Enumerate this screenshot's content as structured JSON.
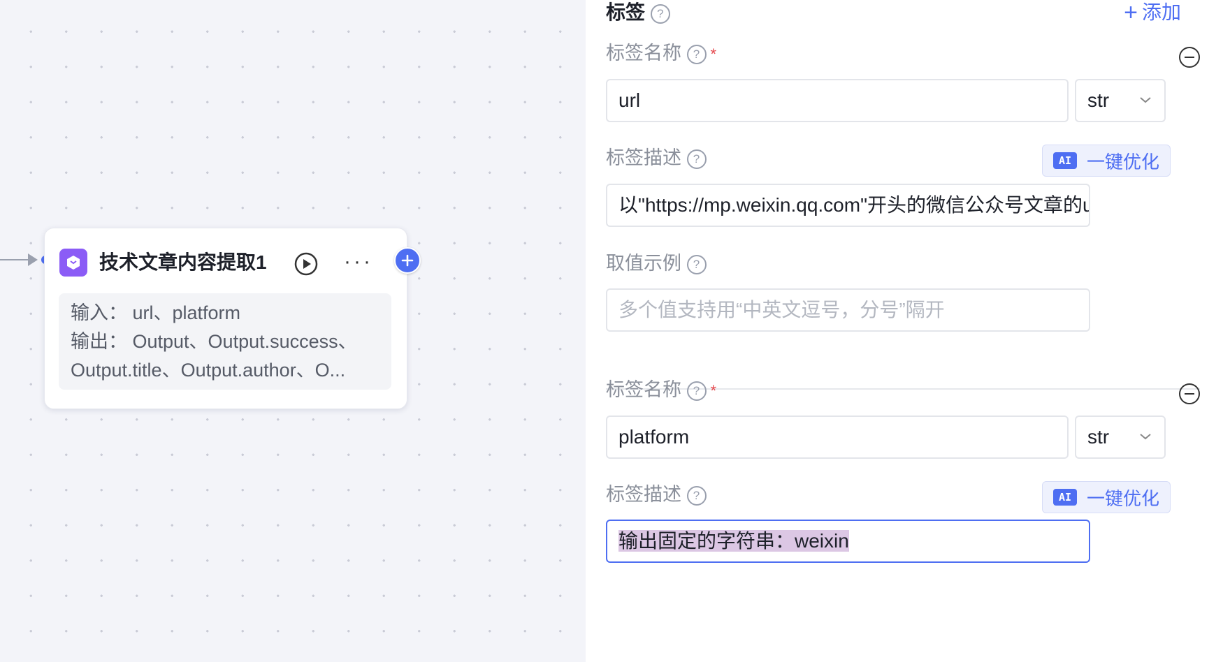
{
  "node": {
    "title": "技术文章内容提取1",
    "input_line": "输入：  url、platform",
    "output_line1": "输出：  Output、Output.success、",
    "output_line2": "Output.title、Output.author、O..."
  },
  "panel": {
    "section_title": "标签",
    "add_label": "添加",
    "tags": [
      {
        "name_label": "标签名称",
        "name_value": "url",
        "type_value": "str",
        "desc_label": "标签描述",
        "desc_value": "以\"https://mp.weixin.qq.com\"开头的微信公众号文章的url",
        "example_label": "取值示例",
        "example_placeholder": "多个值支持用“中英文逗号，分号”隔开",
        "ai_button_label": "一键优化"
      },
      {
        "name_label": "标签名称",
        "name_value": "platform",
        "type_value": "str",
        "desc_label": "标签描述",
        "desc_value": "输出固定的字符串：weixin",
        "ai_button_label": "一键优化"
      }
    ],
    "ai_badge": "AI"
  },
  "colors": {
    "accent": "#4e6ef2",
    "node_icon": "#8b5cf6",
    "required": "#e5484d",
    "selection": "#dcc7e4"
  }
}
